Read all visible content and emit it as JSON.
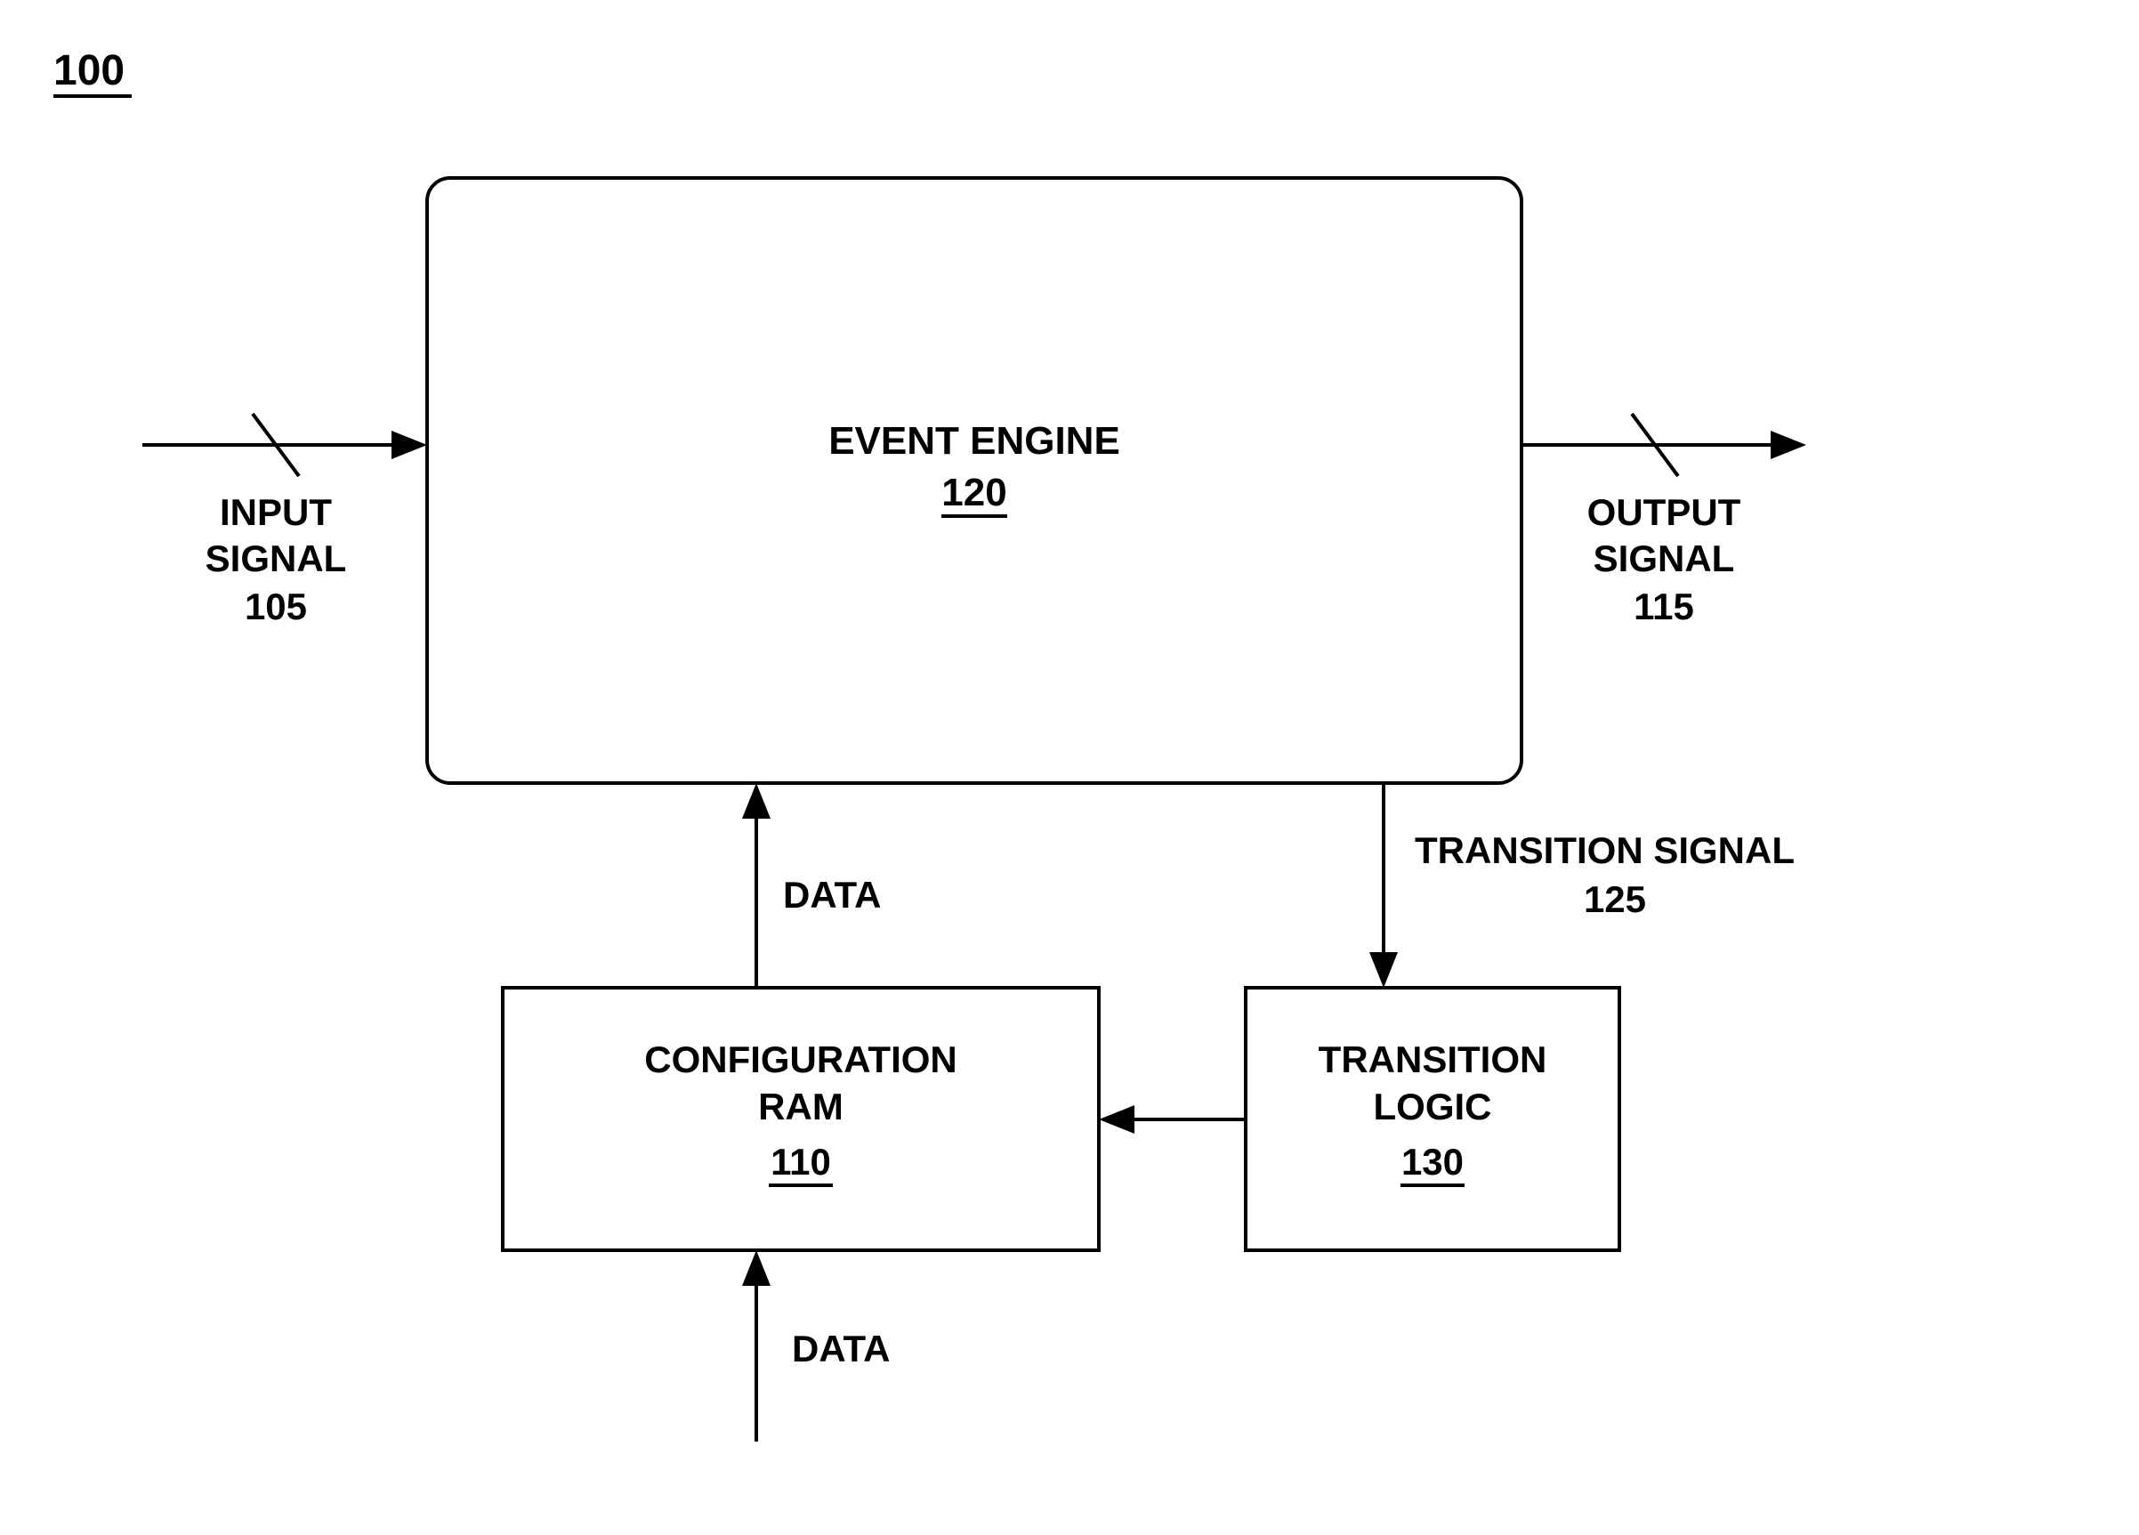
{
  "figure_ref": "100",
  "blocks": {
    "event_engine": {
      "title": "EVENT ENGINE",
      "ref": "120"
    },
    "config_ram": {
      "title_l1": "CONFIGURATION",
      "title_l2": "RAM",
      "ref": "110"
    },
    "trans_logic": {
      "title_l1": "TRANSITION",
      "title_l2": "LOGIC",
      "ref": "130"
    }
  },
  "signals": {
    "input": {
      "l1": "INPUT",
      "l2": "SIGNAL",
      "ref": "105"
    },
    "output": {
      "l1": "OUTPUT",
      "l2": "SIGNAL",
      "ref": "115"
    },
    "transition": {
      "label": "TRANSITION SIGNAL",
      "ref": "125"
    },
    "data_up": "DATA",
    "data_in": "DATA"
  }
}
